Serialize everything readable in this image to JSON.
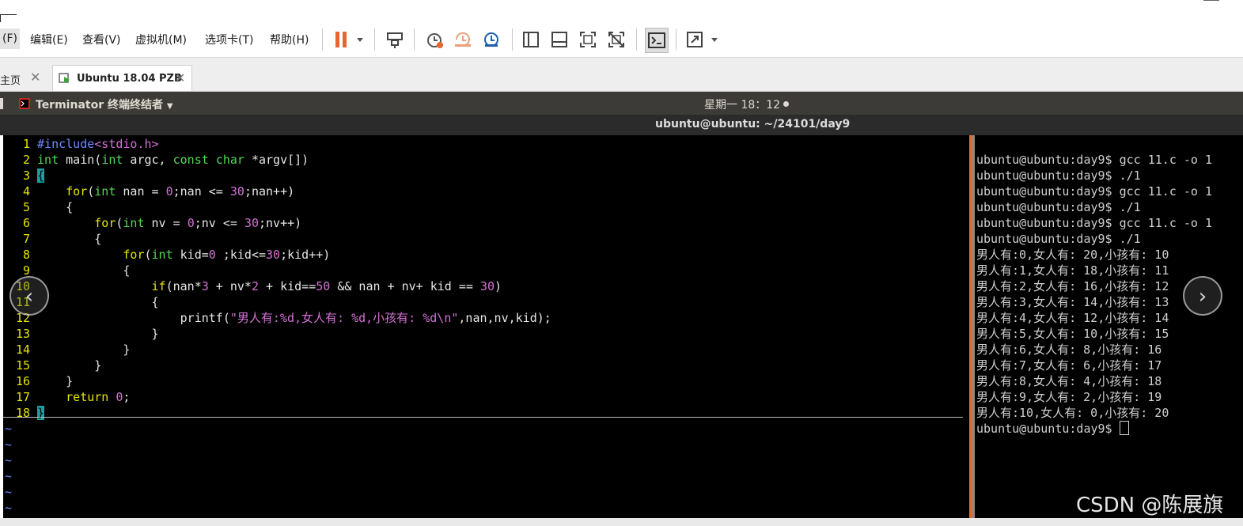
{
  "menubar": {
    "items": [
      "文件(F)",
      "编辑(E)",
      "查看(V)",
      "虚拟机(M)",
      "选项卡(T)",
      "帮助(H)"
    ],
    "first_visible": "(F)"
  },
  "toolbar": {
    "icons": [
      "pause-icon",
      "send-ctrl-alt-del-icon",
      "snapshot-icon",
      "snapshot-revert-icon",
      "snapshot-manager-icon",
      "library-view-icon",
      "thumbnail-view-icon",
      "fullscreen-icon",
      "unity-icon",
      "console-view-icon",
      "stretch-icon"
    ],
    "accent": "#e8662c"
  },
  "tabs": [
    {
      "label": "主页"
    },
    {
      "label": "Ubuntu 18.04 PZB"
    }
  ],
  "panel": {
    "app_name": "Terminator 终端终结者",
    "clock": "星期一 18：12"
  },
  "window": {
    "title": "ubuntu@ubuntu: ~/24101/day9"
  },
  "editor": {
    "lines": [
      {
        "n": "1",
        "parts": [
          [
            "pre",
            "#include"
          ],
          [
            "str",
            "<stdio.h>"
          ]
        ]
      },
      {
        "n": "2",
        "parts": [
          [
            "type",
            "int"
          ],
          [
            "txt",
            " main("
          ],
          [
            "type",
            "int"
          ],
          [
            "txt",
            " argc, "
          ],
          [
            "type",
            "const"
          ],
          [
            "txt",
            " "
          ],
          [
            "type",
            "char"
          ],
          [
            "txt",
            " *argv[])"
          ]
        ]
      },
      {
        "n": "3",
        "parts": [
          [
            "hl",
            "{"
          ]
        ]
      },
      {
        "n": "4",
        "parts": [
          [
            "txt",
            "    "
          ],
          [
            "kw",
            "for"
          ],
          [
            "txt",
            "("
          ],
          [
            "type",
            "int"
          ],
          [
            "txt",
            " nan = "
          ],
          [
            "num",
            "0"
          ],
          [
            "txt",
            ";nan <= "
          ],
          [
            "num",
            "30"
          ],
          [
            "txt",
            ";nan++)"
          ]
        ]
      },
      {
        "n": "5",
        "parts": [
          [
            "txt",
            "    {"
          ]
        ]
      },
      {
        "n": "6",
        "parts": [
          [
            "txt",
            "        "
          ],
          [
            "kw",
            "for"
          ],
          [
            "txt",
            "("
          ],
          [
            "type",
            "int"
          ],
          [
            "txt",
            " nv = "
          ],
          [
            "num",
            "0"
          ],
          [
            "txt",
            ";nv <= "
          ],
          [
            "num",
            "30"
          ],
          [
            "txt",
            ";nv++)"
          ]
        ]
      },
      {
        "n": "7",
        "parts": [
          [
            "txt",
            "        {"
          ]
        ]
      },
      {
        "n": "8",
        "parts": [
          [
            "txt",
            "            "
          ],
          [
            "kw",
            "for"
          ],
          [
            "txt",
            "("
          ],
          [
            "type",
            "int"
          ],
          [
            "txt",
            " kid="
          ],
          [
            "num",
            "0"
          ],
          [
            "txt",
            " ;kid<="
          ],
          [
            "num",
            "30"
          ],
          [
            "txt",
            ";kid++)"
          ]
        ]
      },
      {
        "n": "9",
        "parts": [
          [
            "txt",
            "            {"
          ]
        ]
      },
      {
        "n": "10",
        "parts": [
          [
            "txt",
            "                "
          ],
          [
            "kw",
            "if"
          ],
          [
            "txt",
            "(nan*"
          ],
          [
            "num",
            "3"
          ],
          [
            "txt",
            " + nv*"
          ],
          [
            "num",
            "2"
          ],
          [
            "txt",
            " + kid=="
          ],
          [
            "num",
            "50"
          ],
          [
            "txt",
            " && nan + nv+ kid == "
          ],
          [
            "num",
            "30"
          ],
          [
            "txt",
            ")"
          ]
        ]
      },
      {
        "n": "11",
        "parts": [
          [
            "txt",
            "                {"
          ]
        ]
      },
      {
        "n": "12",
        "parts": [
          [
            "txt",
            "                    printf("
          ],
          [
            "str",
            "\"男人有:%d,女人有: %d,小孩有: %d\\n\""
          ],
          [
            "txt",
            ",nan,nv,kid);"
          ]
        ]
      },
      {
        "n": "13",
        "parts": [
          [
            "txt",
            "                }"
          ]
        ]
      },
      {
        "n": "14",
        "parts": [
          [
            "txt",
            "            }"
          ]
        ]
      },
      {
        "n": "15",
        "parts": [
          [
            "txt",
            "        }"
          ]
        ]
      },
      {
        "n": "16",
        "parts": [
          [
            "txt",
            "    }"
          ]
        ]
      },
      {
        "n": "17",
        "parts": [
          [
            "txt",
            "    "
          ],
          [
            "kw",
            "return"
          ],
          [
            "txt",
            " "
          ],
          [
            "num",
            "0"
          ],
          [
            "txt",
            ";"
          ]
        ]
      },
      {
        "n": "18",
        "parts": [
          [
            "hl",
            "}"
          ]
        ]
      }
    ],
    "tilde": "~"
  },
  "terminal": {
    "lines": [
      "ubuntu@ubuntu:day9$ gcc 11.c -o 1",
      "ubuntu@ubuntu:day9$ ./1",
      "ubuntu@ubuntu:day9$ gcc 11.c -o 1",
      "ubuntu@ubuntu:day9$ ./1",
      "ubuntu@ubuntu:day9$ gcc 11.c -o 1",
      "ubuntu@ubuntu:day9$ ./1",
      "男人有:0,女人有: 20,小孩有: 10",
      "男人有:1,女人有: 18,小孩有: 11",
      "男人有:2,女人有: 16,小孩有: 12",
      "男人有:3,女人有: 14,小孩有: 13",
      "男人有:4,女人有: 12,小孩有: 14",
      "男人有:5,女人有: 10,小孩有: 15",
      "男人有:6,女人有: 8,小孩有: 16",
      "男人有:7,女人有: 6,小孩有: 17",
      "男人有:8,女人有: 4,小孩有: 18",
      "男人有:9,女人有: 2,小孩有: 19",
      "男人有:10,女人有: 0,小孩有: 20"
    ],
    "prompt": "ubuntu@ubuntu:day9$ "
  },
  "nav": {
    "prev": "‹",
    "next": "›"
  },
  "watermark": "CSDN @陈展旗"
}
